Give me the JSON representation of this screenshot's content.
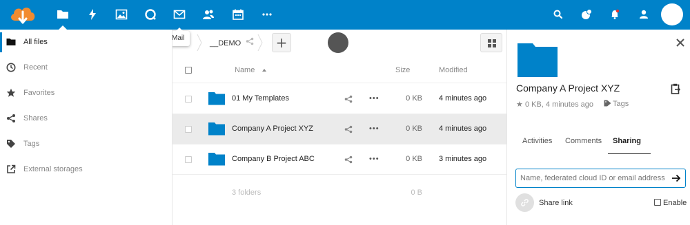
{
  "header": {
    "tooltip": "Mail",
    "apps": [
      {
        "icon": "files-icon"
      },
      {
        "icon": "activity-icon"
      },
      {
        "icon": "gallery-icon"
      },
      {
        "icon": "talk-icon"
      },
      {
        "icon": "mail-icon"
      },
      {
        "icon": "contacts-icon"
      },
      {
        "icon": "calendar-icon"
      },
      {
        "icon": "more-apps-icon"
      }
    ],
    "right_icons": [
      "search-icon",
      "contacts-menu-icon",
      "notifications-icon",
      "user-menu-icon"
    ],
    "colors": {
      "primary": "#0082c9",
      "logo": "#f28b30"
    }
  },
  "nav": {
    "items": [
      {
        "label": "All files",
        "icon": "folder-icon",
        "active": true
      },
      {
        "label": "Recent",
        "icon": "clock-icon"
      },
      {
        "label": "Favorites",
        "icon": "star-icon"
      },
      {
        "label": "Shares",
        "icon": "share-icon"
      },
      {
        "label": "Tags",
        "icon": "tag-icon"
      },
      {
        "label": "External storages",
        "icon": "external-link-icon"
      }
    ]
  },
  "breadcrumb": {
    "current": "__DEMO"
  },
  "table": {
    "headers": {
      "name": "Name",
      "size": "Size",
      "modified": "Modified"
    },
    "rows": [
      {
        "name": "01 My Templates",
        "size": "0 KB",
        "modified": "4 minutes ago",
        "selected": false
      },
      {
        "name": "Company A Project XYZ",
        "size": "0 KB",
        "modified": "4 minutes ago",
        "selected": true
      },
      {
        "name": "Company B Project ABC",
        "size": "0 KB",
        "modified": "3 minutes ago",
        "selected": false
      }
    ],
    "more_label": "•••",
    "summary": {
      "count": "3 folders",
      "total": "0 B"
    }
  },
  "sidebar": {
    "title": "Company A Project XYZ",
    "meta": "0 KB, 4 minutes ago",
    "tags_label": "Tags",
    "tabs": [
      {
        "label": "Activities"
      },
      {
        "label": "Comments"
      },
      {
        "label": "Sharing",
        "active": true
      }
    ],
    "share_placeholder": "Name, federated cloud ID or email address ...",
    "share_link_label": "Share link",
    "enable_label": "Enable"
  }
}
